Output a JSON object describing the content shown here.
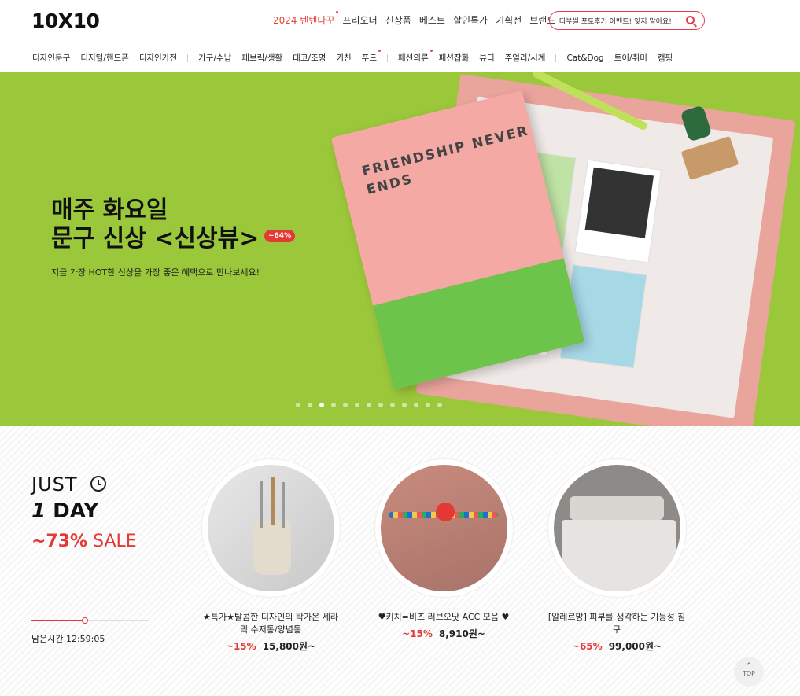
{
  "logo": "10X10",
  "topnav": [
    {
      "label": "2024 텐텐다꾸",
      "red": true,
      "dot": true
    },
    {
      "label": "프리오더",
      "red": false,
      "dot": false
    },
    {
      "label": "신상품",
      "red": false,
      "dot": false
    },
    {
      "label": "베스트",
      "red": false,
      "dot": false
    },
    {
      "label": "할인특가",
      "red": false,
      "dot": false
    },
    {
      "label": "기획전",
      "red": false,
      "dot": false
    },
    {
      "label": "브랜드",
      "red": false,
      "dot": false
    }
  ],
  "search": {
    "text": "따부씰 포토후기 이벤트! 잊지 말아요!"
  },
  "categories": [
    "디자인문구",
    "디지털/핸드폰",
    "디자인가전",
    "|",
    "가구/수납",
    "패브릭/생활",
    "데코/조명",
    "키친",
    "푸드",
    "|",
    "패션의류",
    "패션잡화",
    "뷰티",
    "주얼리/시계",
    "|",
    "Cat&Dog",
    "토이/취미",
    "캠핑"
  ],
  "hero": {
    "line1": "매주 화요일",
    "line2": "문구 신상 <신상뷰>",
    "badge": "~64%",
    "subtitle": "지금 가장 HOT한 신상을 가장 좋은 혜택으로 만나보세요!",
    "notebook_text": "FRIENDSHIP NEVER ENDS",
    "slide_count": 13,
    "active_slide": 3
  },
  "justday": {
    "just": "JUST",
    "oneday_num": "1",
    "oneday_word": "DAY",
    "sale_pct": "~73%",
    "sale_word": "SALE",
    "remaining_label": "남은시간 12:59:05",
    "progress": 0.45
  },
  "products": [
    {
      "name": "★특가★탈콤한 디자인의 탁가온 세라믹 수저통/양념통",
      "discount": "~15%",
      "price": "15,800원~",
      "image": "ceramic-utensil-holder"
    },
    {
      "name": "♥키치=비즈 러브오낫 ACC 모음 ♥",
      "discount": "~15%",
      "price": "8,910원~",
      "image": "bead-rings"
    },
    {
      "name": "[알레르망] 피부를 생각하는 기능성 침구",
      "discount": "~65%",
      "price": "99,000원~",
      "image": "bedding"
    }
  ],
  "top_button": "TOP",
  "colors": {
    "accent": "#e53935",
    "hero_bg": "#9bc73a"
  }
}
